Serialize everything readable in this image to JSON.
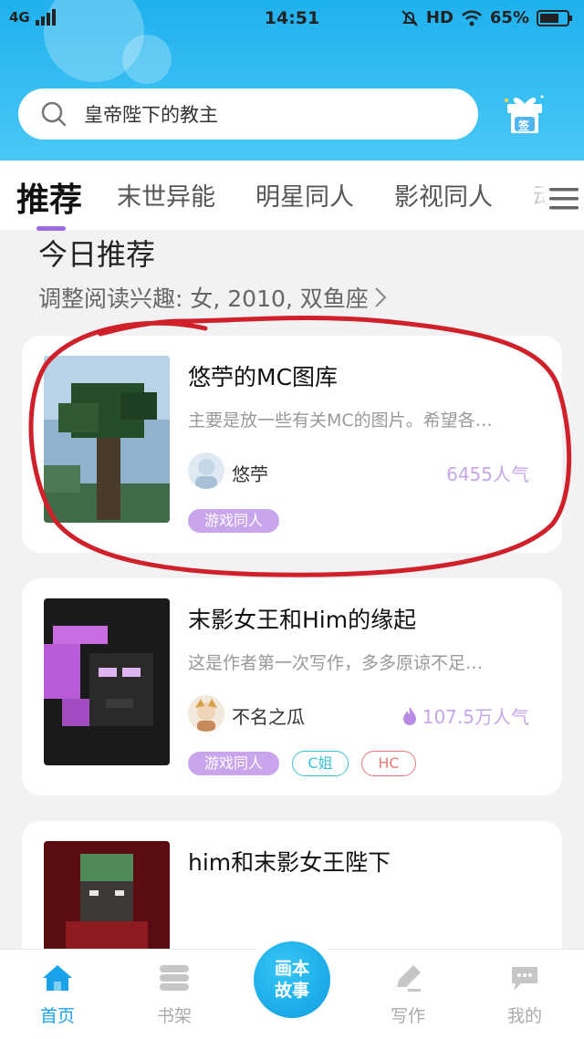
{
  "status_bar": {
    "network": "4G",
    "time": "14:51",
    "hd": "HD",
    "battery": "65%"
  },
  "search": {
    "placeholder": "皇帝陛下的教主"
  },
  "gift_label": "签",
  "tabs": [
    {
      "label": "推荐",
      "active": true
    },
    {
      "label": "末世异能",
      "active": false
    },
    {
      "label": "明星同人",
      "active": false
    },
    {
      "label": "影视同人",
      "active": false
    },
    {
      "label": "动",
      "active": false
    }
  ],
  "section": {
    "title": "今日推荐",
    "subtitle": "调整阅读兴趣: 女, 2010, 双鱼座"
  },
  "stories": [
    {
      "title": "悠苧的MC图库",
      "desc": "主要是放一些有关MC的图片。希望各…",
      "author": "悠苧",
      "popularity": "6455人气",
      "hot": false,
      "tags": [
        {
          "label": "游戏同人",
          "style": "fill"
        }
      ]
    },
    {
      "title": "末影女王和Him的缘起",
      "desc": "这是作者第一次写作，多多原谅不足…",
      "author": "不名之瓜",
      "popularity": "107.5万人气",
      "hot": true,
      "tags": [
        {
          "label": "游戏同人",
          "style": "fill"
        },
        {
          "label": "C姐",
          "style": "cyan"
        },
        {
          "label": "HC",
          "style": "red"
        }
      ]
    },
    {
      "title": "him和末影女王陛下",
      "author": ""
    }
  ],
  "bottom_nav": {
    "items": [
      {
        "label": "首页",
        "icon": "home-icon",
        "active": true
      },
      {
        "label": "书架",
        "icon": "bookshelf-icon",
        "active": false
      },
      {
        "label": "写作",
        "icon": "pencil-icon",
        "active": false
      },
      {
        "label": "我的",
        "icon": "chat-bubble-icon",
        "active": false
      }
    ],
    "center_button": {
      "line1": "画本",
      "line2": "故事"
    }
  },
  "colors": {
    "accent": "#1aa3ea",
    "tab_indicator": "#9b6be0",
    "tag_purple": "#c9a6ec",
    "annotation_red": "#d0202a"
  }
}
